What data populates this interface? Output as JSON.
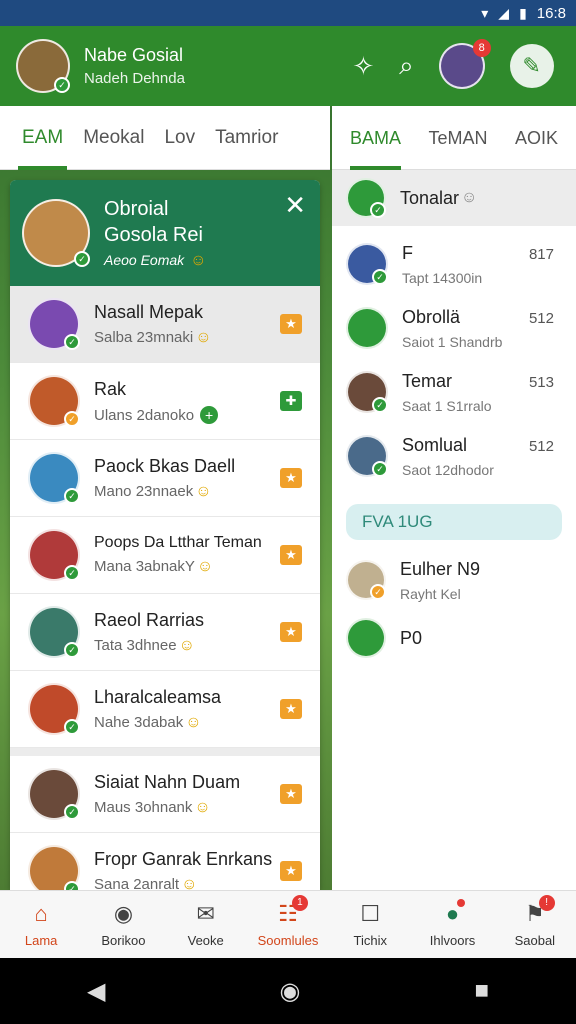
{
  "status_bar": {
    "time": "16:8"
  },
  "left_header": {
    "title": "Nabe Gosial",
    "subtitle": "Nadeh Dehnda",
    "avatar_color": "#8a6a3a"
  },
  "left_tabs": [
    {
      "label": "EAM",
      "active": true
    },
    {
      "label": "Meokal",
      "active": false
    },
    {
      "label": "Lov",
      "active": false
    },
    {
      "label": "Tamrior",
      "active": false
    }
  ],
  "card": {
    "title_line1": "Obroial",
    "title_line2": "Gosola Rei",
    "subtitle": "Aeoo Eomak",
    "close_icon": "close-icon",
    "contacts": [
      {
        "name": "Nasall Mepak",
        "status": "Salba 23mnaki",
        "selected": true,
        "badge": "star",
        "avatar": "#7a4ab0"
      },
      {
        "name": "Rak",
        "status": "Ulans 2danoko",
        "selected": false,
        "badge": "plus",
        "avatar": "#c05a2a"
      },
      {
        "name": "Paock Bkas Daell",
        "status": "Mano 23nnaek",
        "selected": false,
        "badge": "star",
        "avatar": "#3a8ac0"
      },
      {
        "name": "Poops Da Ltthar Teman",
        "status": "Mana 3abnakY",
        "selected": false,
        "badge": "star",
        "avatar": "#b03a3a"
      },
      {
        "name": "Raeol Rarrias",
        "status": "Tata 3dhnee",
        "selected": false,
        "badge": "star",
        "avatar": "#3a7a6a"
      },
      {
        "name": "Lharalcaleamsa",
        "status": "Nahe 3dabak",
        "selected": false,
        "badge": "star",
        "avatar": "#c04a2a"
      },
      {
        "name": "Siaiat Nahn Duam",
        "status": "Maus 3ohnank",
        "selected": false,
        "badge": "star",
        "avatar": "#6a4a3a"
      },
      {
        "name": "Fropr Ganrak Enrkans",
        "status": "Sana 2anralt",
        "selected": false,
        "badge": "star",
        "avatar": "#c07a3a"
      }
    ]
  },
  "right_header": {
    "notif_count": "8"
  },
  "right_tabs": [
    {
      "label": "BAMA",
      "active": true
    },
    {
      "label": "TeMAN",
      "active": false
    },
    {
      "label": "AOIK",
      "active": false
    }
  ],
  "right_panel": {
    "top_contact": "Tonalar",
    "contacts": [
      {
        "name": "F",
        "sub": "Tapt 14300in",
        "count": "817",
        "avatar": "#3a5aa0"
      },
      {
        "name": "Obrollä",
        "sub": "Saiot 1 Shandrb",
        "count": "512",
        "avatar": "#2e9a3a"
      },
      {
        "name": "Temar",
        "sub": "Saat 1 S1rralo",
        "count": "513",
        "avatar": "#6a4a3a"
      },
      {
        "name": "Somlual",
        "sub": "Saot 12dhodor",
        "count": "512",
        "avatar": "#4a6a8a"
      }
    ],
    "section_label": "FVA 1UG",
    "more_contacts": [
      {
        "name": "Eulher N9",
        "sub": "Rayht Kel",
        "avatar": "#c0b090"
      },
      {
        "name": "P0",
        "sub": "",
        "avatar": "#2e9a3a"
      }
    ]
  },
  "bottom_nav": [
    {
      "label": "Lama",
      "icon": "home-icon",
      "active": true,
      "badge": ""
    },
    {
      "label": "Borikoo",
      "icon": "compass-icon",
      "active": false,
      "badge": ""
    },
    {
      "label": "Veoke",
      "icon": "mail-icon",
      "active": false,
      "badge": ""
    },
    {
      "label": "Soomlules",
      "icon": "people-icon",
      "active": false,
      "badge": "1"
    },
    {
      "label": "Tichix",
      "icon": "chart-icon",
      "active": false,
      "badge": ""
    },
    {
      "label": "Ihlvoors",
      "icon": "explore-icon",
      "active": false,
      "badge": "dot"
    },
    {
      "label": "Saobal",
      "icon": "alert-icon",
      "active": false,
      "badge": "!"
    }
  ]
}
